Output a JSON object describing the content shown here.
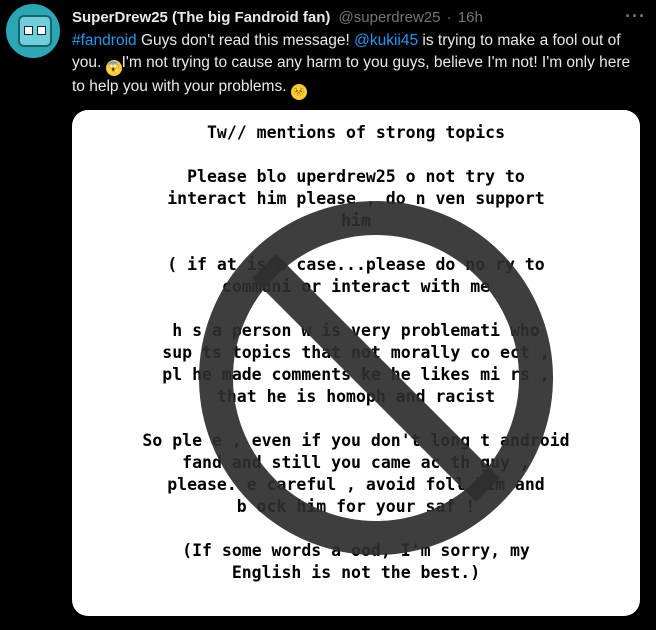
{
  "tweet": {
    "display_name": "SuperDrew25 (The big Fandroid fan)",
    "handle": "@superdrew25",
    "separator": "·",
    "time": "16h",
    "more_label": "···",
    "hashtag": "#fandroid",
    "text_part1": " Guys don't read this message! ",
    "mention": "@kukii45",
    "text_part2": " is trying to make a fool out of you. ",
    "text_part3": "I'm not trying to cause any harm to you guys, believe I'm not! I'm only here to help you with your problems. ",
    "emoji_1": "scream-emoji",
    "emoji_2": "confounded-emoji"
  },
  "media": {
    "lines": [
      "Tw// mentions of strong topics",
      "Please blo    uperdrew25      o not try to\ninteract     him please , do n    ven support\nhim",
      "( if   at is   e case...please do no   ry to\ncommuni      or interact with me",
      "h   s a person w    is very problemati   who\nsup   ts topics that     not morally co   ect ,\npl   he made comments     ke he likes mi    rs ,\nthat he is homoph      and racist",
      "So ple   e , even if you don't    long t    android\nfand    and still you came ac      th   guy ,\nplease.   e careful , avoid foll      him and\nb    ock him for your saf    !",
      "(If some words a                 ood, I'm sorry, my\nEnglish is not the best.)"
    ],
    "overlay_icon": "prohibition-sign-icon",
    "overlay_color": "#2e2e2e"
  }
}
